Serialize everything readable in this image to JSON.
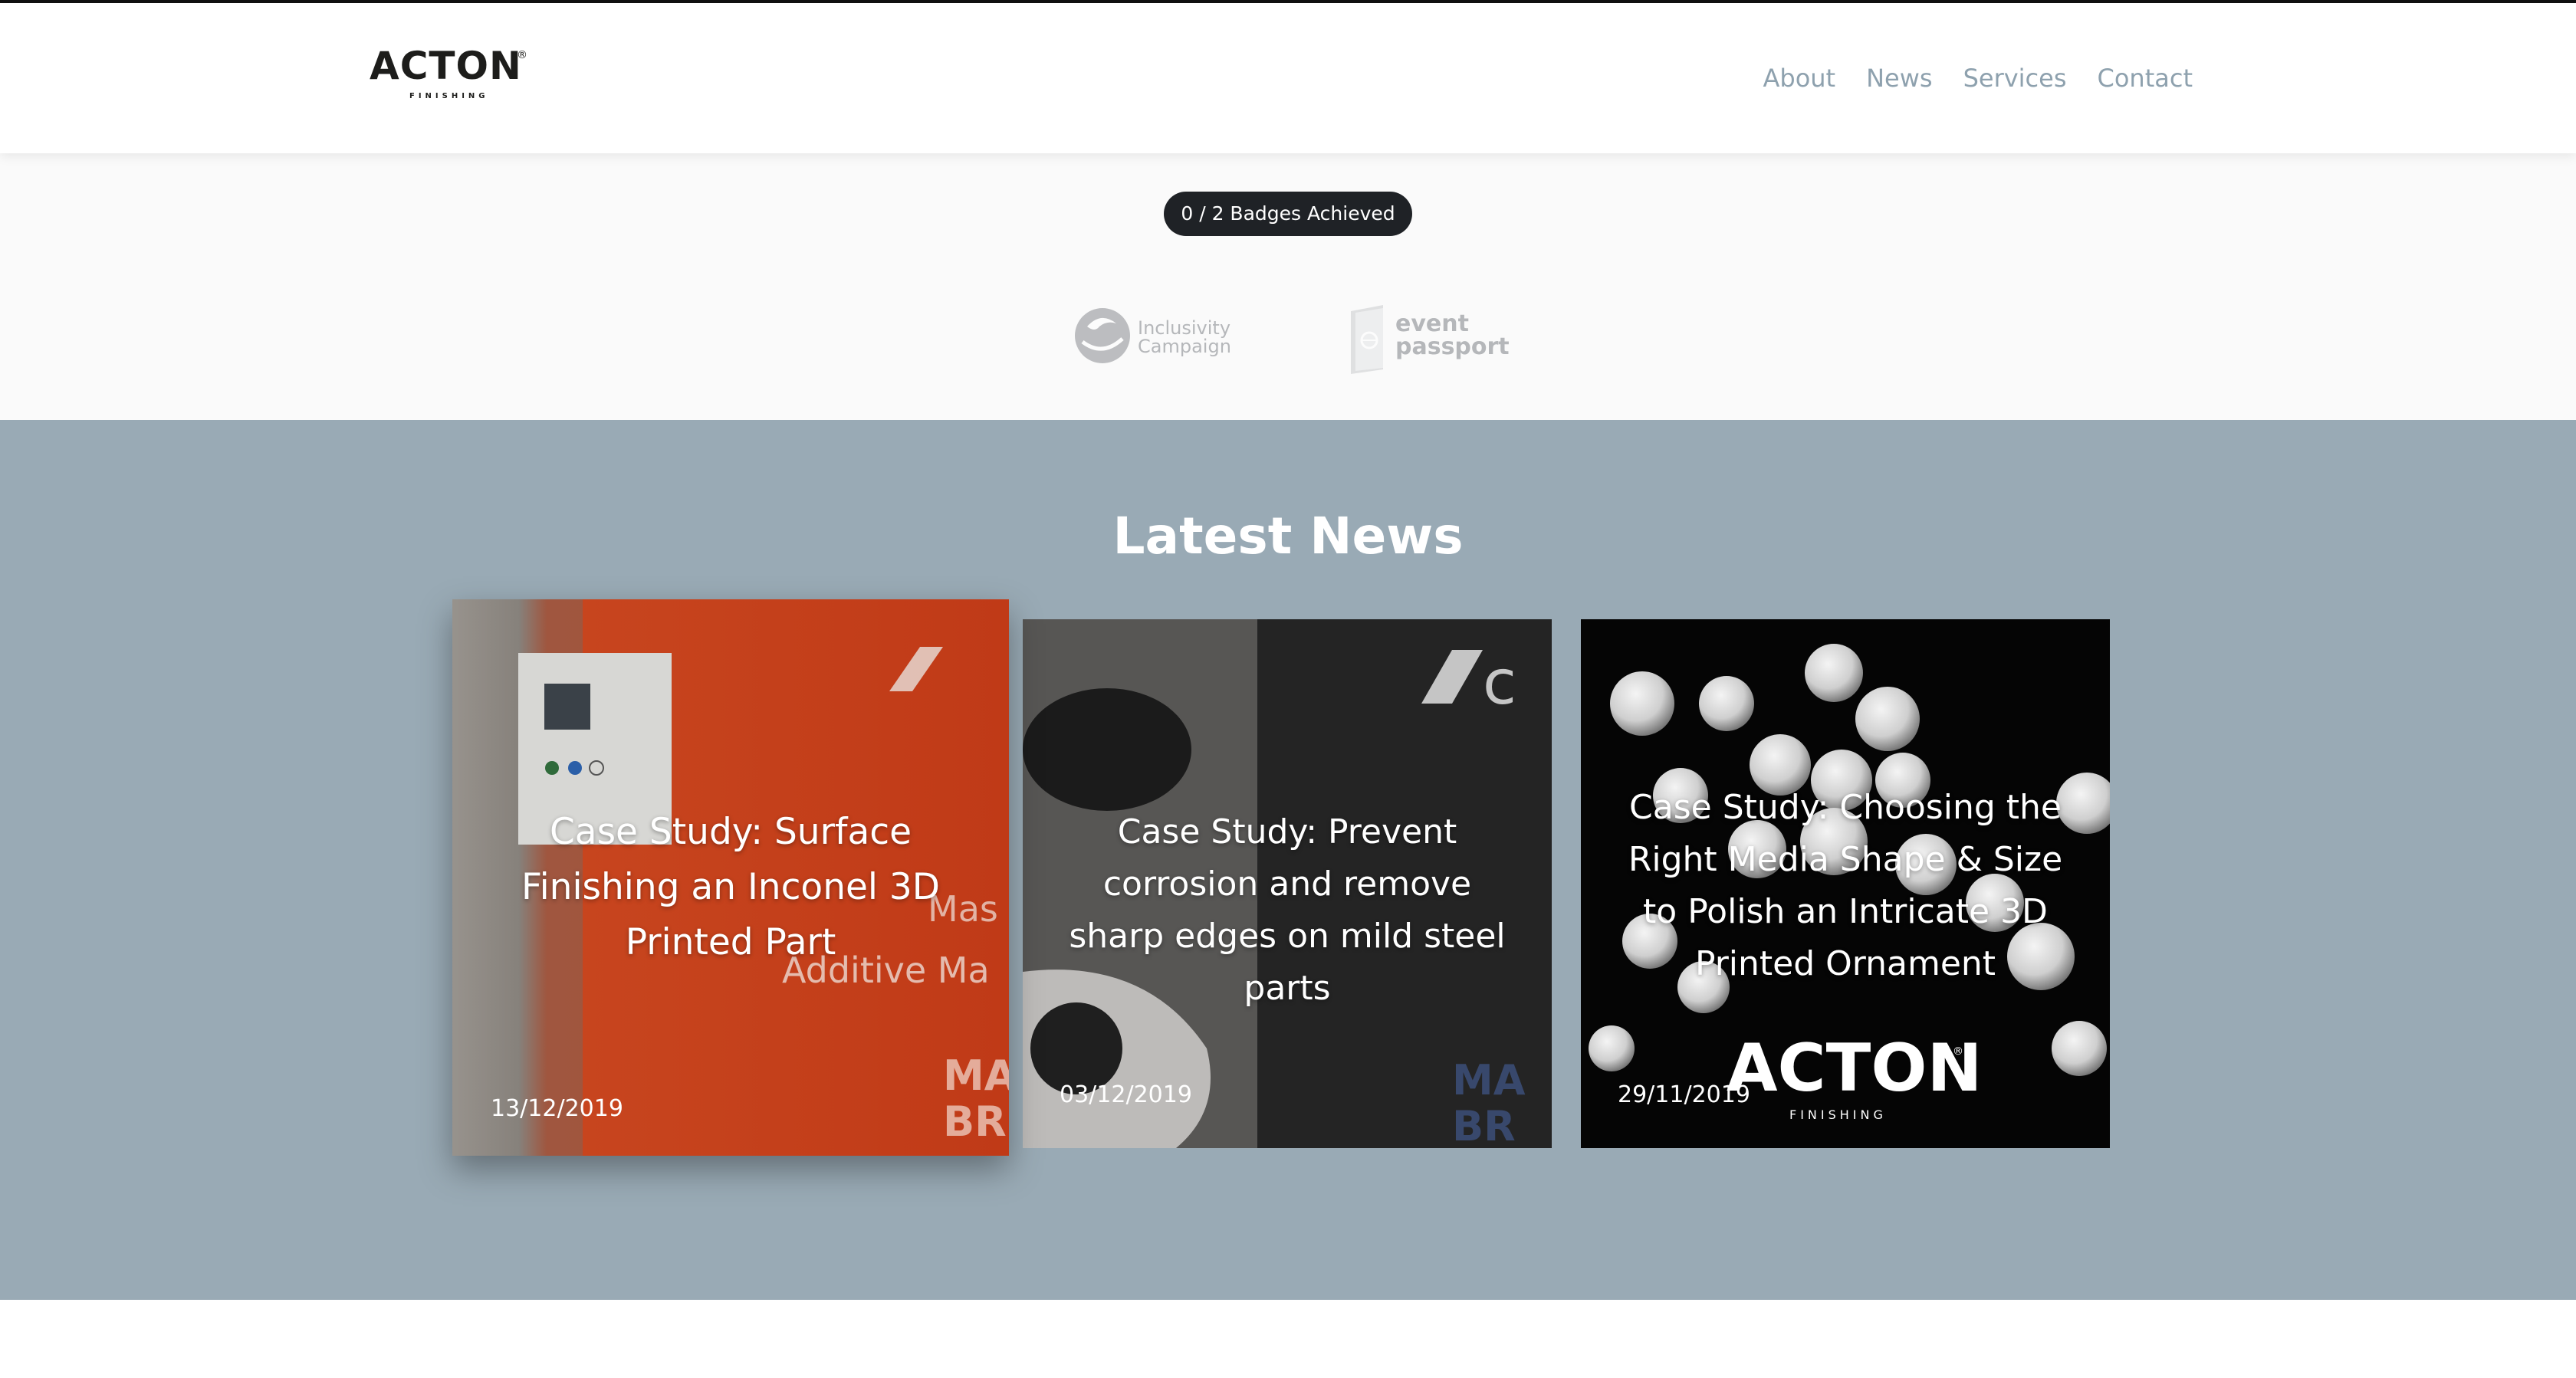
{
  "header": {
    "logo_text": "ACTON",
    "logo_sub": "FINISHING",
    "logo_reg": "®",
    "nav": [
      "About",
      "News",
      "Services",
      "Contact"
    ]
  },
  "badges": {
    "pill": "0 / 2 Badges Achieved",
    "items": [
      {
        "name": "Inclusivity Campaign",
        "line1": "Inclusivity",
        "line2": "Campaign"
      },
      {
        "name": "event passport",
        "line1": "event",
        "line2": "passport"
      }
    ]
  },
  "news": {
    "title": "Latest News",
    "cards": [
      {
        "title": "Case Study: Surface Finishing an Inconel 3D Printed Part",
        "date": "13/12/2019"
      },
      {
        "title": "Case Study: Prevent corrosion and remove sharp edges on mild steel parts",
        "date": "03/12/2019"
      },
      {
        "title": "Case Study: Choosing the Right Media Shape & Size to Polish an Intricate 3D Printed Ornament",
        "date": "29/11/2019"
      }
    ]
  },
  "colors": {
    "news_bg": "#99aab5",
    "nav_text": "#8ea1ae",
    "pill_bg": "#1f2226",
    "card1_accent": "#c8401c"
  }
}
